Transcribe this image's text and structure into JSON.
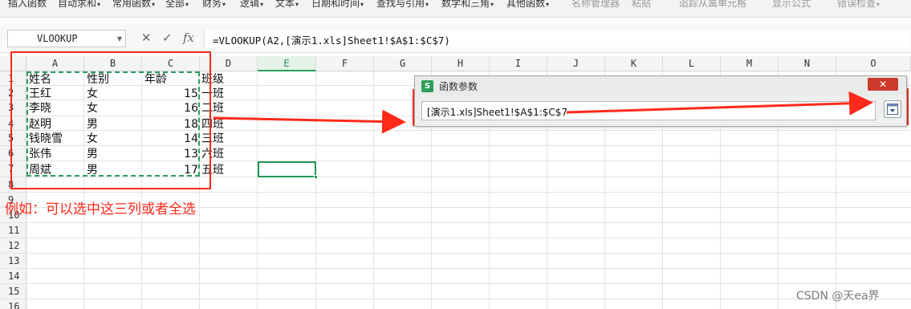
{
  "ribbon": {
    "items": [
      {
        "label": "插入函数",
        "caret": ""
      },
      {
        "label": "自动求和",
        "caret": "▾"
      },
      {
        "label": "常用函数",
        "caret": "▾"
      },
      {
        "label": "全部",
        "caret": "▾"
      },
      {
        "label": "财务",
        "caret": "▾"
      },
      {
        "label": "逻辑",
        "caret": "▾"
      },
      {
        "label": "文本",
        "caret": "▾"
      },
      {
        "label": "日期和时间",
        "caret": "▾"
      },
      {
        "label": "查找与引用",
        "caret": "▾"
      },
      {
        "label": "数学和三角",
        "caret": "▾"
      },
      {
        "label": "其他函数",
        "caret": "▾"
      },
      {
        "label": "名称管理器",
        "caret": ""
      },
      {
        "label": "粘贴",
        "caret": ""
      },
      {
        "label": "追踪从属单元格",
        "caret": ""
      },
      {
        "label": "显示公式",
        "caret": ""
      },
      {
        "label": "错误检查",
        "caret": "▾"
      }
    ]
  },
  "formula_bar": {
    "name_box": "VLOOKUP",
    "cancel_icon": "✕",
    "confirm_icon": "✓",
    "fx_icon": "fx",
    "formula": "=VLOOKUP(A2,[演示1.xls]Sheet1!$A$1:$C$7)"
  },
  "grid": {
    "columns": [
      "A",
      "B",
      "C",
      "D",
      "E",
      "F",
      "G",
      "H",
      "I",
      "J",
      "K",
      "L",
      "M",
      "N",
      "O"
    ],
    "selected_column": "E",
    "rows": [
      "1",
      "2",
      "3",
      "4",
      "5",
      "6",
      "7",
      "8",
      "9",
      "10",
      "11",
      "12",
      "13",
      "14",
      "15",
      "16"
    ],
    "header": {
      "a": "姓名",
      "b": "性别",
      "c": "年龄",
      "d": "班级"
    },
    "records": [
      {
        "a": "王红",
        "b": "女",
        "c": "15",
        "d": "一班"
      },
      {
        "a": "李晓",
        "b": "女",
        "c": "16",
        "d": "二班"
      },
      {
        "a": "赵明",
        "b": "男",
        "c": "18",
        "d": "四班"
      },
      {
        "a": "钱晓雪",
        "b": "女",
        "c": "14",
        "d": "三班"
      },
      {
        "a": "张伟",
        "b": "男",
        "c": "13",
        "d": "六班"
      },
      {
        "a": "周斌",
        "b": "男",
        "c": "17",
        "d": "五班"
      }
    ]
  },
  "annotation": {
    "note": "例如：可以选中这三列或者全选",
    "color": "#ff2a1a"
  },
  "dialog": {
    "title": "函数参数",
    "logo": "S",
    "close": "✕",
    "range_value": "[演示1.xls]Sheet1!$A$1:$C$7",
    "collapse_button_icon": "collapse-dialog-icon"
  },
  "watermark": "CSDN @天ea界",
  "colors": {
    "accent_green": "#2e9e5f",
    "annotation_red": "#ff2a1a",
    "close_red": "#cb3a2c"
  }
}
